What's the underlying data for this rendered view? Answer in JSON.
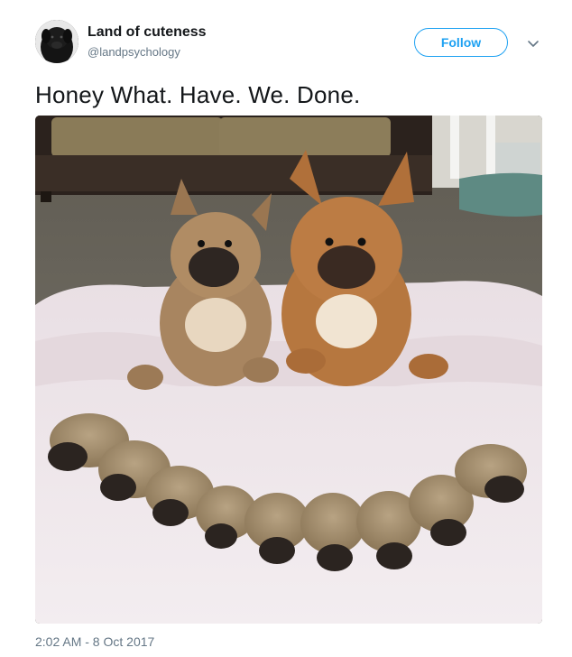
{
  "tweet": {
    "display_name": "Land of cuteness",
    "handle": "@landpsychology",
    "follow_label": "Follow",
    "text": "Honey What. Have. We. Done.",
    "timestamp": "2:02 AM - 8 Oct 2017"
  },
  "icons": {
    "more_menu": "chevron-down-icon"
  },
  "colors": {
    "accent": "#1da1f2",
    "secondary_text": "#657786",
    "primary_text": "#14171a"
  }
}
